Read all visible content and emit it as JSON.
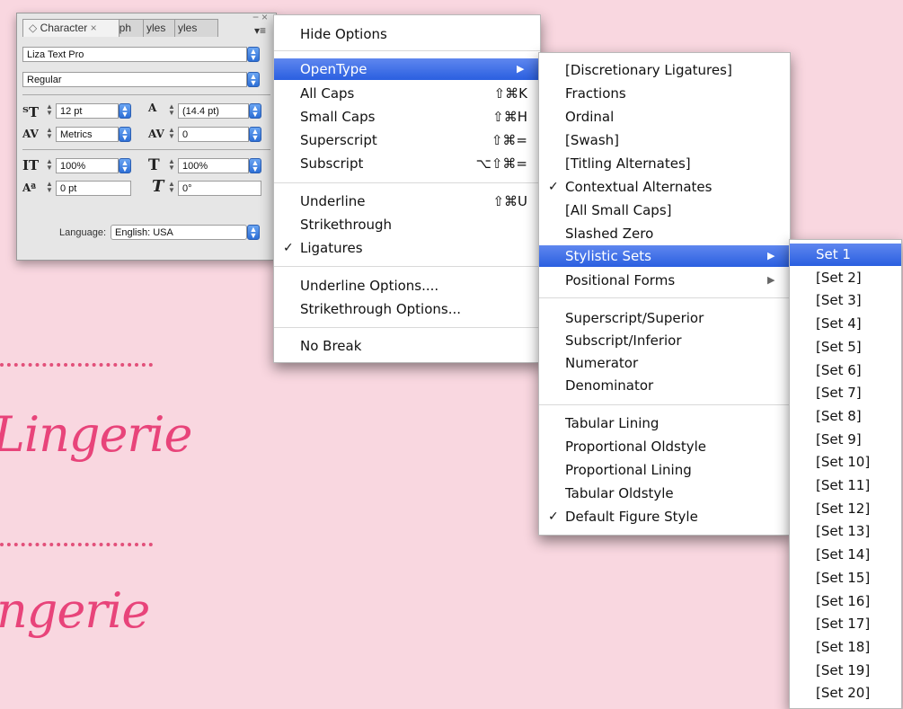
{
  "background": {
    "words": [
      "Lingerie",
      "ngerie"
    ]
  },
  "panel": {
    "tabs": [
      "Character",
      "aph",
      "yles",
      "yles"
    ],
    "tab_close": "×",
    "active_tab_icon": "◇",
    "window_controls": [
      "−",
      "×"
    ],
    "menu_icon": "▾≡",
    "font_family": "Liza Text Pro",
    "font_style": "Regular",
    "font_size": "12 pt",
    "leading": "(14.4 pt)",
    "kerning": "Metrics",
    "tracking": "0",
    "vertical_scale": "100%",
    "horizontal_scale": "100%",
    "baseline_shift": "0 pt",
    "skew": "0°",
    "language_label": "Language:",
    "language_value": "English: USA"
  },
  "main_menu": {
    "items": [
      {
        "label": "Hide Options"
      },
      {
        "label": "OpenType",
        "submenu": true,
        "highlighted": true
      },
      {
        "label": "All Caps",
        "shortcut": "⇧⌘K"
      },
      {
        "label": "Small Caps",
        "shortcut": "⇧⌘H"
      },
      {
        "label": "Superscript",
        "shortcut": "⇧⌘="
      },
      {
        "label": "Subscript",
        "shortcut": "⌥⇧⌘="
      },
      {
        "label": "Underline",
        "shortcut": "⇧⌘U"
      },
      {
        "label": "Strikethrough"
      },
      {
        "label": "Ligatures",
        "checked": true
      },
      {
        "label": "Underline Options...."
      },
      {
        "label": "Strikethrough Options..."
      },
      {
        "label": "No Break"
      }
    ]
  },
  "opentype_menu": {
    "items": [
      {
        "label": "[Discretionary Ligatures]"
      },
      {
        "label": "Fractions"
      },
      {
        "label": "Ordinal"
      },
      {
        "label": "[Swash]"
      },
      {
        "label": "[Titling Alternates]"
      },
      {
        "label": "Contextual Alternates",
        "checked": true
      },
      {
        "label": "[All Small Caps]"
      },
      {
        "label": "Slashed Zero"
      },
      {
        "label": "Stylistic Sets",
        "submenu": true,
        "highlighted": true
      },
      {
        "label": "Positional Forms",
        "submenu": true
      },
      {
        "label": "Superscript/Superior"
      },
      {
        "label": "Subscript/Inferior"
      },
      {
        "label": "Numerator"
      },
      {
        "label": "Denominator"
      },
      {
        "label": "Tabular Lining"
      },
      {
        "label": "Proportional Oldstyle"
      },
      {
        "label": "Proportional Lining"
      },
      {
        "label": "Tabular Oldstyle"
      },
      {
        "label": "Default Figure Style",
        "checked": true
      }
    ]
  },
  "stylistic_sets_menu": {
    "items": [
      "Set 1",
      "[Set 2]",
      "[Set 3]",
      "[Set 4]",
      "[Set 5]",
      "[Set 6]",
      "[Set 7]",
      "[Set 8]",
      "[Set 9]",
      "[Set 10]",
      "[Set 11]",
      "[Set 12]",
      "[Set 13]",
      "[Set 14]",
      "[Set 15]",
      "[Set 16]",
      "[Set 17]",
      "[Set 18]",
      "[Set 19]",
      "[Set 20]"
    ],
    "highlighted_index": 0
  },
  "glyphs": {
    "check": "✓",
    "arrow": "▶",
    "step_up_down": "▲▼"
  },
  "colors": {
    "background": "#f9d7e0",
    "accent_pink": "#e8447a",
    "menu_highlight": "#2a5fe0"
  }
}
